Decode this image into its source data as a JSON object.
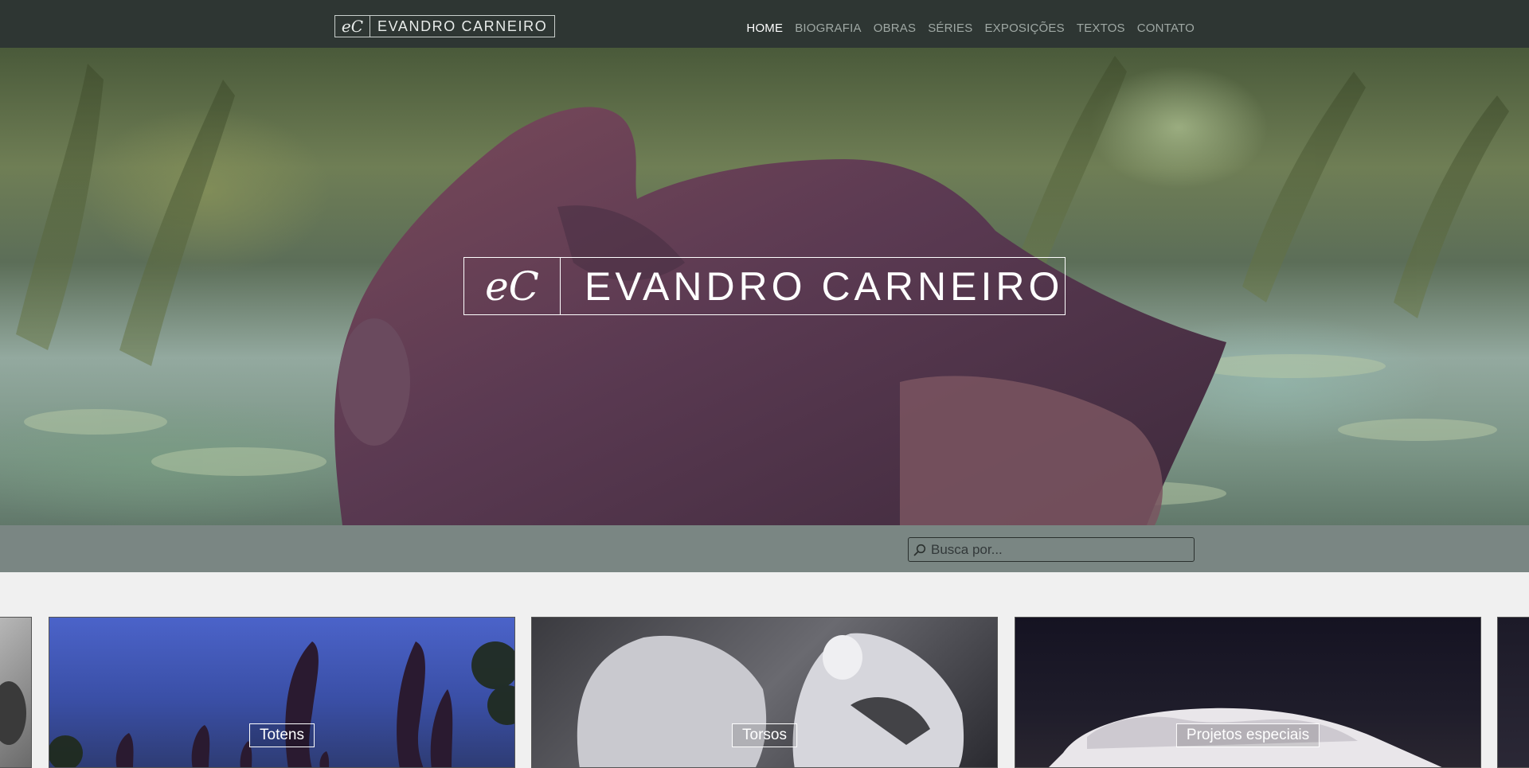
{
  "header": {
    "logo_monogram": "eC",
    "logo_name": "EVANDRO CARNEIRO",
    "nav": [
      {
        "label": "HOME",
        "active": true
      },
      {
        "label": "BIOGRAFIA",
        "active": false
      },
      {
        "label": "OBRAS",
        "active": false
      },
      {
        "label": "SÉRIES",
        "active": false
      },
      {
        "label": "EXPOSIÇÕES",
        "active": false
      },
      {
        "label": "TEXTOS",
        "active": false
      },
      {
        "label": "CONTATO",
        "active": false
      }
    ]
  },
  "hero": {
    "monogram": "eC",
    "title": "EVANDRO CARNEIRO"
  },
  "search": {
    "placeholder": "Busca por...",
    "value": ""
  },
  "series": [
    {
      "label": "Totens"
    },
    {
      "label": "Torsos"
    },
    {
      "label": "Projetos especiais"
    }
  ],
  "colors": {
    "topbar": "#2e3633",
    "search_band": "#7a8683",
    "page_bg": "#f0f0f0",
    "sculpture": "#5a3a4e"
  }
}
